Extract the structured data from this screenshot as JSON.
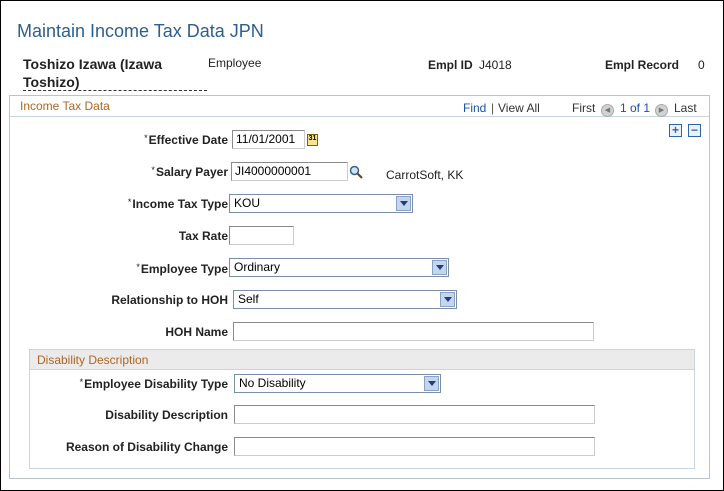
{
  "page": {
    "title": "Maintain Income Tax Data JPN"
  },
  "header": {
    "name_line1": "Toshizo Izawa (Izawa",
    "name_line2": "Toshizo)",
    "role": "Employee",
    "empl_id_label": "Empl ID",
    "empl_id": "J4018",
    "empl_record_label": "Empl Record",
    "empl_record": "0"
  },
  "group": {
    "title": "Income Tax Data",
    "find": "Find",
    "sep": "|",
    "view_all": "View All",
    "first": "First",
    "count": "1 of 1",
    "last": "Last",
    "add_label": "+",
    "remove_label": "−"
  },
  "fields": {
    "effective_date": {
      "label": "Effective Date",
      "value": "11/01/2001"
    },
    "salary_payer": {
      "label": "Salary Payer",
      "value": "JI4000000001",
      "description": "CarrotSoft, KK"
    },
    "income_tax_type": {
      "label": "Income Tax Type",
      "value": "KOU"
    },
    "tax_rate": {
      "label": "Tax Rate",
      "value": ""
    },
    "employee_type": {
      "label": "Employee Type",
      "value": "Ordinary"
    },
    "relationship_hoh": {
      "label": "Relationship to HOH",
      "value": "Self"
    },
    "hoh_name": {
      "label": "HOH Name",
      "value": ""
    }
  },
  "disability": {
    "title": "Disability Description",
    "type": {
      "label": "Employee Disability Type",
      "value": "No Disability"
    },
    "description": {
      "label": "Disability Description",
      "value": ""
    },
    "reason": {
      "label": "Reason of Disability Change",
      "value": ""
    }
  },
  "required_mark": "*",
  "calendar_glyph": "31"
}
